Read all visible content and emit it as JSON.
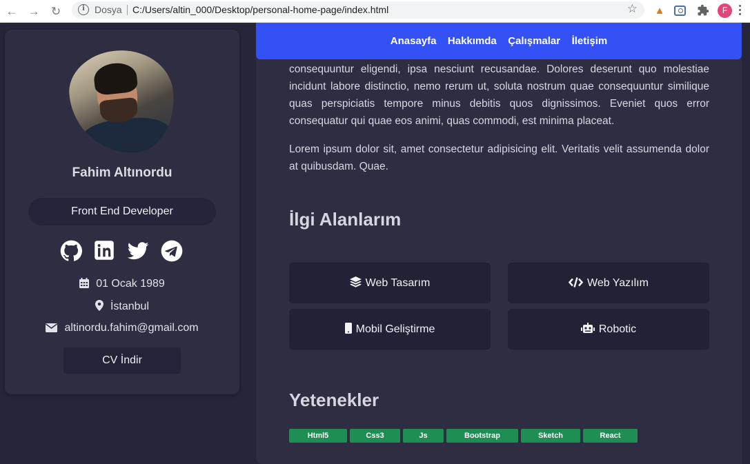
{
  "browser": {
    "scheme_label": "Dosya",
    "url": "C:/Users/altin_000/Desktop/personal-home-page/index.html",
    "profile_initial": "F"
  },
  "sidebar": {
    "name": "Fahim Altınordu",
    "role": "Front End Developer",
    "socials": [
      "github-icon",
      "linkedin-icon",
      "twitter-icon",
      "telegram-icon"
    ],
    "birthdate": "01 Ocak 1989",
    "city": "İstanbul",
    "email": "altinordu.fahim@gmail.com",
    "cv_button": "CV İndir"
  },
  "nav": {
    "links": [
      "Anasayfa",
      "Hakkımda",
      "Çalışmalar",
      "İletişim"
    ]
  },
  "main": {
    "para1": "consequuntur eligendi, ipsa nesciunt recusandae. Dolores deserunt quo molestiae incidunt labore distinctio, nemo rerum ut, soluta nostrum quae consequuntur similique quas perspiciatis tempore minus debitis quos dignissimos. Eveniet quos error consequatur qui quae eos animi, quas commodi, est minima placeat.",
    "para2": "Lorem ipsum dolor sit, amet consectetur adipisicing elit. Veritatis velit assumenda dolor at quibusdam. Quae.",
    "interests_title": "İlgi Alanlarım",
    "interests": [
      {
        "label": "Web Tasarım",
        "icon": "layers-icon"
      },
      {
        "label": "Web Yazılım",
        "icon": "code-icon"
      },
      {
        "label": "Mobil Geliştirme",
        "icon": "mobile-icon"
      },
      {
        "label": "Robotic",
        "icon": "robot-icon"
      }
    ],
    "skills_title": "Yetenekler",
    "skills": [
      "Html5",
      "Css3",
      "Js",
      "Bootstrap",
      "Sketch",
      "React"
    ]
  },
  "colors": {
    "page_bg": "#27253a",
    "panel_bg": "#2f2d42",
    "nav_accent": "#3451f6",
    "skill_badge": "#1f8e52"
  }
}
